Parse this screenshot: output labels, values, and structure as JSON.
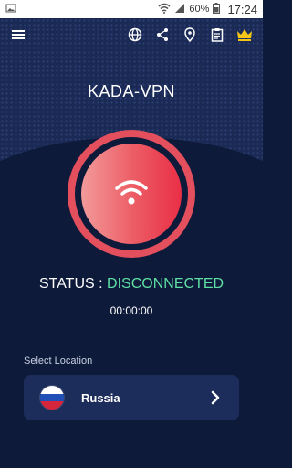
{
  "status_bar": {
    "battery": "60%",
    "time": "17:24"
  },
  "toolbar": {
    "icons": [
      "menu-icon",
      "globe-icon",
      "share-icon",
      "location-pin-icon",
      "clipboard-icon",
      "crown-icon"
    ],
    "crown_color": "#f5c518"
  },
  "app": {
    "title": "KADA-VPN"
  },
  "connection": {
    "status_label": "STATUS :",
    "status_value": "DISCONNECTED",
    "status_color": "#5fe0a4",
    "timer": "00:00:00"
  },
  "location": {
    "label": "Select Location",
    "country": "Russia",
    "flag_colors": [
      "#ffffff",
      "#1f4fb7",
      "#d5263b"
    ]
  }
}
